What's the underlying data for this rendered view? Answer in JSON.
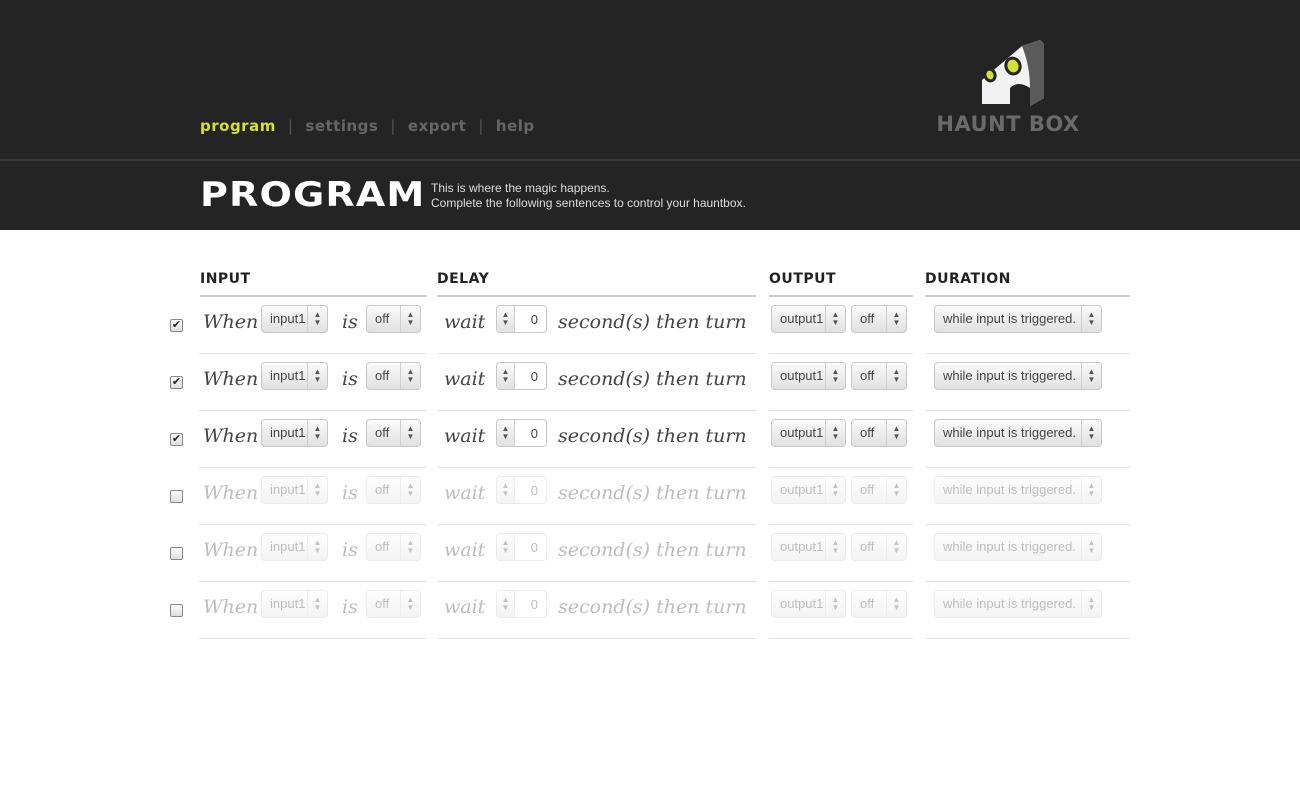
{
  "nav": {
    "items": [
      {
        "label": "program",
        "active": true
      },
      {
        "label": "settings",
        "active": false
      },
      {
        "label": "export",
        "active": false
      },
      {
        "label": "help",
        "active": false
      }
    ],
    "separator": "|"
  },
  "logo": {
    "text": "HAUNT BOX"
  },
  "page": {
    "title": "PROGRAM",
    "intro_line1": "This is where the magic happens.",
    "intro_line2": "Complete the following sentences to control your hauntbox."
  },
  "columns": {
    "input": "INPUT",
    "delay": "DELAY",
    "output": "OUTPUT",
    "duration": "DURATION"
  },
  "sentence": {
    "when": "When",
    "is": "is",
    "wait": "wait",
    "seconds_then_turn": "second(s) then turn"
  },
  "rows": [
    {
      "enabled": true,
      "input": "input1",
      "input_state": "off",
      "delay": "0",
      "output": "output1",
      "output_state": "off",
      "duration": "while input is triggered."
    },
    {
      "enabled": true,
      "input": "input1",
      "input_state": "off",
      "delay": "0",
      "output": "output1",
      "output_state": "off",
      "duration": "while input is triggered."
    },
    {
      "enabled": true,
      "input": "input1",
      "input_state": "off",
      "delay": "0",
      "output": "output1",
      "output_state": "off",
      "duration": "while input is triggered."
    },
    {
      "enabled": false,
      "input": "input1",
      "input_state": "off",
      "delay": "0",
      "output": "output1",
      "output_state": "off",
      "duration": "while input is triggered."
    },
    {
      "enabled": false,
      "input": "input1",
      "input_state": "off",
      "delay": "0",
      "output": "output1",
      "output_state": "off",
      "duration": "while input is triggered."
    },
    {
      "enabled": false,
      "input": "input1",
      "input_state": "off",
      "delay": "0",
      "output": "output1",
      "output_state": "off",
      "duration": "while input is triggered."
    }
  ],
  "colors": {
    "header_bg": "#242424",
    "nav_active": "#d4e034",
    "nav_inactive": "#666666",
    "logo_accent": "#d4e034"
  },
  "icons": {
    "checkbox_checked": "check-icon",
    "select_arrows": "up-down-arrows-icon"
  }
}
